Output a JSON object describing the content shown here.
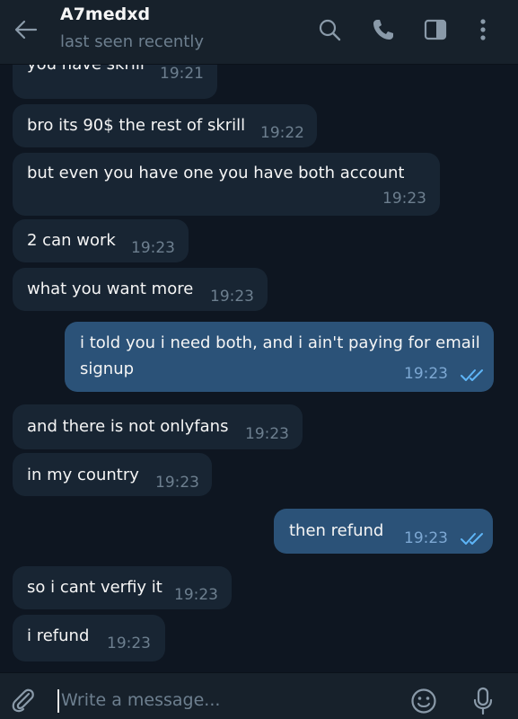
{
  "header": {
    "name": "A7medxd",
    "status": "last seen recently"
  },
  "messages": [
    {
      "dir": "in",
      "text": "you have skrill",
      "time": "19:21"
    },
    {
      "dir": "in",
      "text": "bro its 90$ the rest of skrill",
      "time": "19:22"
    },
    {
      "dir": "in",
      "text": "but even you have one you have both account",
      "time": "19:23"
    },
    {
      "dir": "in",
      "text": "2 can work",
      "time": "19:23"
    },
    {
      "dir": "in",
      "text": "what you want more",
      "time": "19:23"
    },
    {
      "dir": "out",
      "text_line1": "i told you i need both, and i ain't paying for email",
      "text_line2": "signup",
      "time": "19:23",
      "status": "read"
    },
    {
      "dir": "in",
      "text": "and there is not onlyfans",
      "time": "19:23"
    },
    {
      "dir": "in",
      "text": "in my country",
      "time": "19:23"
    },
    {
      "dir": "out",
      "text": "then refund",
      "time": "19:23",
      "status": "read"
    },
    {
      "dir": "in",
      "text": "so i cant verfiy it",
      "time": "19:23"
    },
    {
      "dir": "in",
      "text": "i refund",
      "time": "19:23"
    }
  ],
  "composer": {
    "placeholder": "Write a message..."
  },
  "icons": [
    "back-arrow-icon",
    "search-icon",
    "phone-icon",
    "sidebar-panel-icon",
    "more-vertical-icon",
    "paperclip-icon",
    "emoji-icon",
    "microphone-icon"
  ],
  "colors": {
    "background": "#0e1621",
    "header": "#17212b",
    "incoming_bubble": "#182533",
    "outgoing_bubble": "#2b5278",
    "read_ticks": "#5eb5f7"
  }
}
